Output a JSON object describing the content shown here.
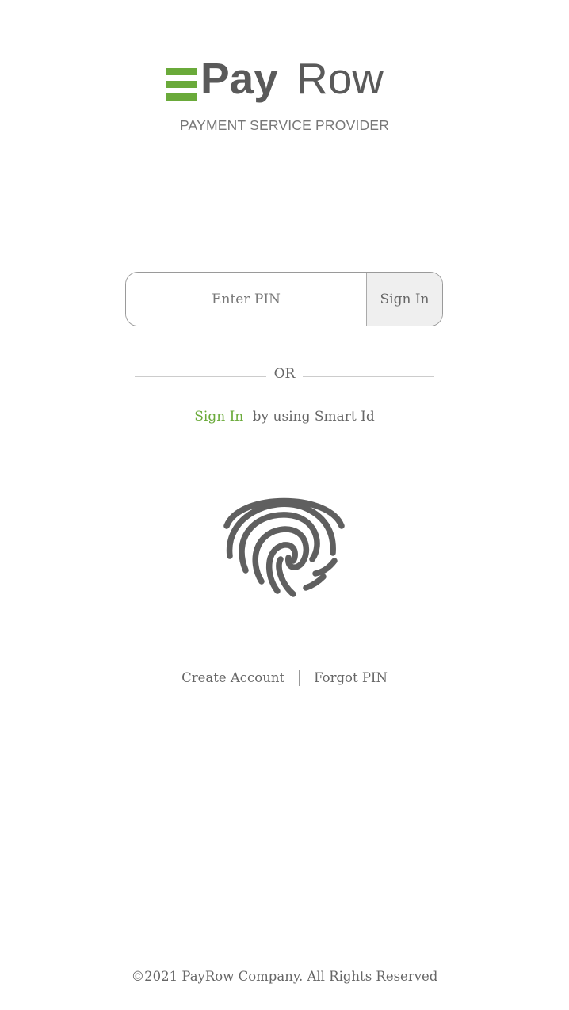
{
  "brand": {
    "name_bold": "Pay",
    "name_light": "Row",
    "tagline": "PAYMENT SERVICE PROVIDER",
    "accent_color": "#6aaa3a",
    "text_color": "#5a5a5a"
  },
  "login": {
    "pin_placeholder": "Enter PIN",
    "signin_label": "Sign In"
  },
  "divider": {
    "label": "OR"
  },
  "smart_id": {
    "link_label": "Sign In",
    "suffix": "by using Smart Id",
    "icon": "fingerprint-icon"
  },
  "links": {
    "create_account": "Create Account",
    "forgot_pin": "Forgot PIN"
  },
  "footer": {
    "copyright": "©2021 PayRow Company. All Rights Reserved"
  }
}
